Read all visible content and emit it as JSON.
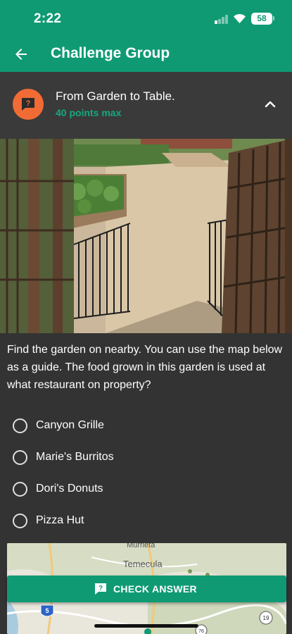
{
  "status_bar": {
    "time": "2:22",
    "battery": "58"
  },
  "app_bar": {
    "title": "Challenge Group"
  },
  "challenge": {
    "title": "From Garden to Table.",
    "points": "40 points max"
  },
  "question": "Find the garden on nearby. You can use the map below as a guide. The food grown in this garden is used at what restaurant on property?",
  "options": [
    "Canyon Grille",
    "Marie's Burritos",
    "Dori's Donuts",
    "Pizza Hut"
  ],
  "map": {
    "city_label": "Temecula",
    "partial_label": "Murrieta",
    "highway_labels": [
      "5",
      "19",
      "76"
    ]
  },
  "actions": {
    "check_answer": "CHECK ANSWER"
  },
  "colors": {
    "primary": "#0f9a74",
    "accent_orange": "#f26b35",
    "background": "#333333",
    "points_green": "#15a87f"
  },
  "icons": [
    "back-arrow-icon",
    "chat-question-icon",
    "chevron-up-icon",
    "radio-icon",
    "wifi-icon",
    "signal-icon",
    "battery-icon"
  ]
}
